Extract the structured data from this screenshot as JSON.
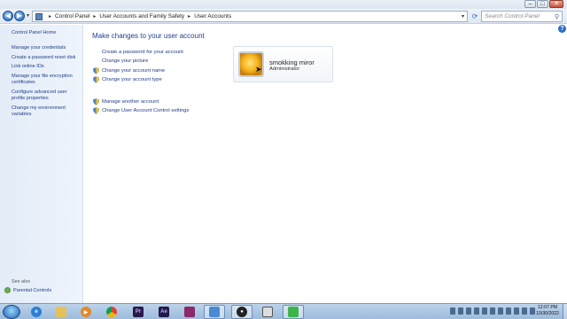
{
  "window": {
    "minimize_label": "–",
    "maximize_label": "□",
    "close_label": "✕"
  },
  "address_bar": {
    "breadcrumb": [
      "Control Panel",
      "User Accounts and Family Safety",
      "User Accounts"
    ],
    "separator": "▸",
    "dropdown_glyph": "▾",
    "refresh_glyph": "⟳",
    "search_placeholder": "Search Control Panel"
  },
  "sidebar": {
    "links": [
      {
        "label": "Control Panel Home"
      },
      {
        "label": "Manage your credentials"
      },
      {
        "label": "Create a password reset disk"
      },
      {
        "label": "Link online IDs"
      },
      {
        "label": "Manage your file encryption certificates"
      },
      {
        "label": "Configure advanced user profile properties"
      },
      {
        "label": "Change my environment variables"
      }
    ],
    "see_also": "See also",
    "parental_controls": "Parental Controls"
  },
  "main": {
    "title": "Make changes to your user account",
    "tasks": [
      {
        "label": "Create a password for your account",
        "shield": false
      },
      {
        "label": "Change your picture",
        "shield": false
      },
      {
        "label": "Change your account name",
        "shield": true
      },
      {
        "label": "Change your account type",
        "shield": true
      }
    ],
    "other_tasks": [
      {
        "label": "Manage another account",
        "shield": true
      },
      {
        "label": "Change User Account Control settings",
        "shield": true
      }
    ]
  },
  "account": {
    "name": "smokking miror",
    "role": "Administrator"
  },
  "taskbar": {
    "apps": [
      {
        "name": "internet-explorer",
        "glyph": "e",
        "color": "#2a7fd4"
      },
      {
        "name": "file-explorer",
        "glyph": "",
        "color": "#e6c15a"
      },
      {
        "name": "media-player",
        "glyph": "▶",
        "color": "#e08a2a"
      },
      {
        "name": "chrome",
        "glyph": "",
        "color": "#3c9a4a"
      },
      {
        "name": "premiere-pro",
        "glyph": "Pr",
        "color": "#2a1a4a"
      },
      {
        "name": "after-effects",
        "glyph": "Ae",
        "color": "#1e1a4a"
      },
      {
        "name": "winrar",
        "glyph": "",
        "color": "#8a2a6a"
      },
      {
        "name": "control-panel",
        "glyph": "",
        "color": "#4a8ad4"
      },
      {
        "name": "recorder",
        "glyph": "●",
        "color": "#222222"
      },
      {
        "name": "window-app",
        "glyph": "",
        "color": "#dddddd"
      },
      {
        "name": "green-app",
        "glyph": "",
        "color": "#3bb54a"
      }
    ],
    "time": "12:07 PM",
    "date": "10/30/2022"
  }
}
